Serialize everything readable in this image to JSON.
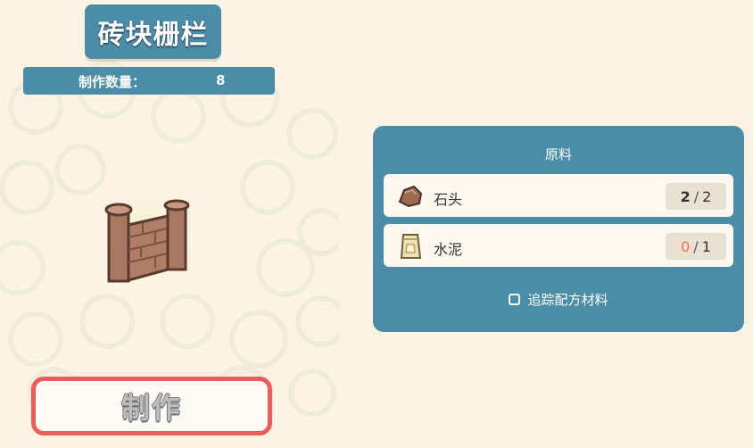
{
  "item": {
    "title": "砖块栅栏",
    "quantity_label": "制作数量：",
    "quantity_value": "8"
  },
  "craft_button": {
    "label": "制作"
  },
  "materials_panel": {
    "title": "原料",
    "items": [
      {
        "name": "石头",
        "have": "2",
        "sep": "/",
        "need": "2",
        "icon": "stone-icon"
      },
      {
        "name": "水泥",
        "have": "0",
        "sep": "/",
        "need": "1",
        "icon": "cement-bag-icon"
      }
    ],
    "track_label": "追踪配方材料",
    "track_checked": false
  },
  "colors": {
    "panel": "#4b8ca8",
    "background": "#fdf3e3",
    "craft_border": "#ef5b5b",
    "lack_count": "#f06a52"
  }
}
